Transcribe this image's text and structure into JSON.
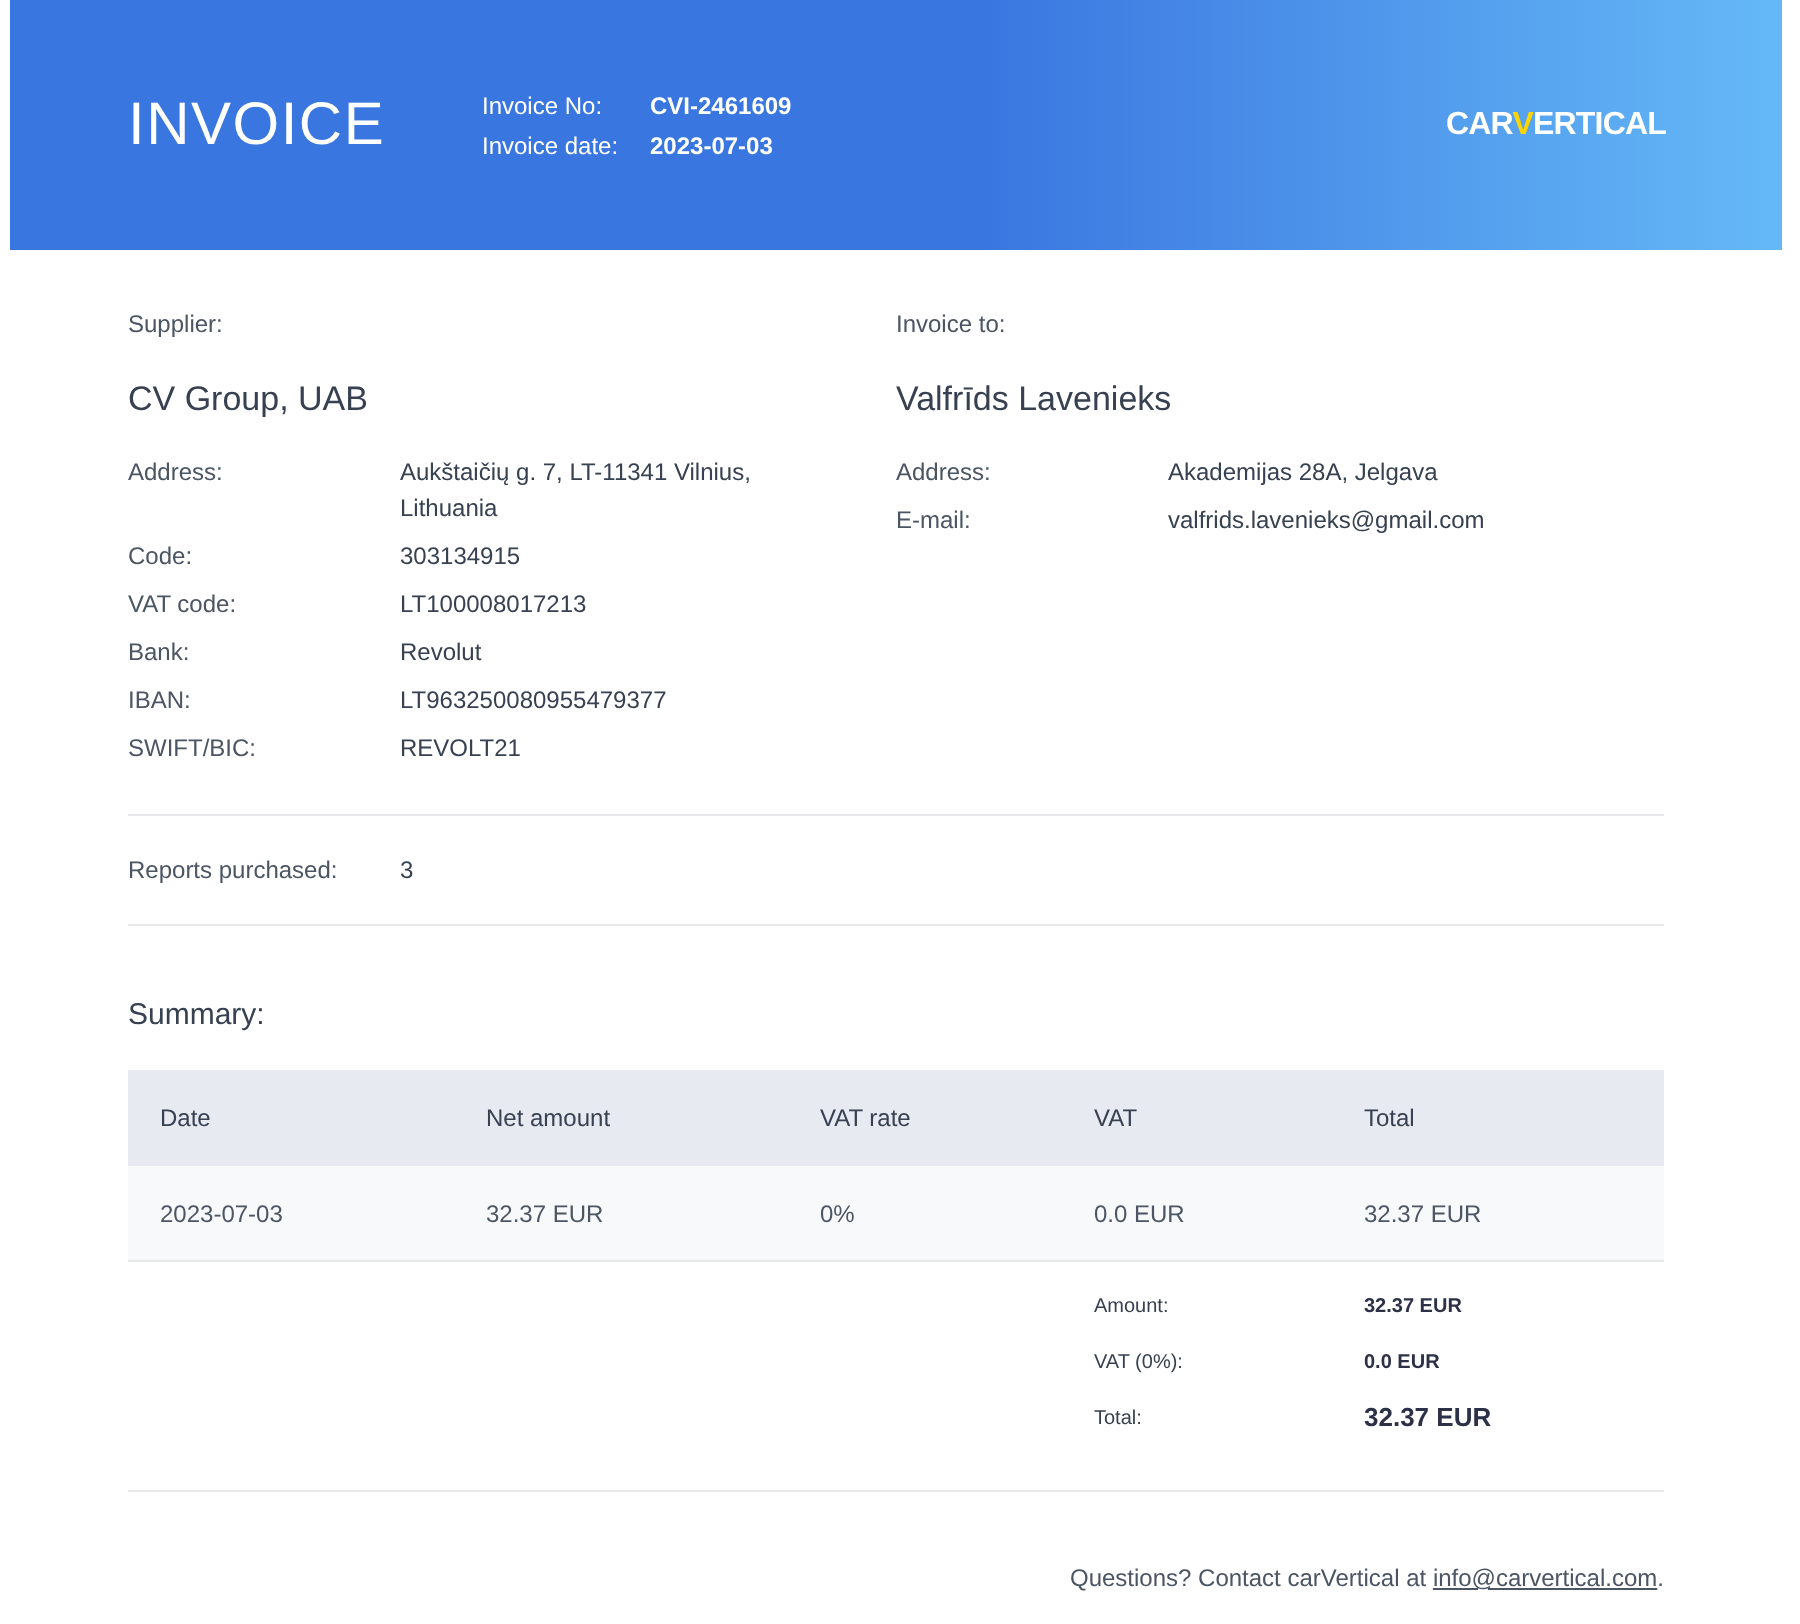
{
  "header": {
    "title": "INVOICE",
    "meta": [
      {
        "label": "Invoice No:",
        "value": "CVI-2461609"
      },
      {
        "label": "Invoice date:",
        "value": "2023-07-03"
      }
    ],
    "logo": {
      "before": "CAR",
      "accent": "V",
      "after": "ERTICAL"
    }
  },
  "supplier": {
    "heading": "Supplier:",
    "name": "CV Group, UAB",
    "fields": [
      {
        "label": "Address:",
        "value": "Aukštaičių g. 7, LT-11341 Vilnius, Lithuania"
      },
      {
        "label": "Code:",
        "value": "303134915"
      },
      {
        "label": "VAT code:",
        "value": "LT100008017213"
      },
      {
        "label": "Bank:",
        "value": "Revolut"
      },
      {
        "label": "IBAN:",
        "value": "LT963250080955479377"
      },
      {
        "label": "SWIFT/BIC:",
        "value": "REVOLT21"
      }
    ]
  },
  "customer": {
    "heading": "Invoice to:",
    "name": "Valfrīds Lavenieks",
    "fields": [
      {
        "label": "Address:",
        "value": "Akademijas 28A, Jelgava"
      },
      {
        "label": "E-mail:",
        "value": "valfrids.lavenieks@gmail.com"
      }
    ]
  },
  "reports": {
    "label": "Reports purchased:",
    "value": "3"
  },
  "summary": {
    "title": "Summary:",
    "columns": [
      "Date",
      "Net amount",
      "VAT rate",
      "VAT",
      "Total"
    ],
    "rows": [
      [
        "2023-07-03",
        "32.37 EUR",
        "0%",
        "0.0 EUR",
        "32.37 EUR"
      ]
    ],
    "totals": [
      {
        "label": "Amount:",
        "value": "32.37 EUR",
        "kind": "normal"
      },
      {
        "label": "VAT (0%):",
        "value": "0.0 EUR",
        "kind": "normal"
      },
      {
        "label": "Total:",
        "value": "32.37 EUR",
        "kind": "grand"
      }
    ]
  },
  "footer": {
    "text": "Questions? Contact carVertical at ",
    "link": "info@carvertical.com",
    "end": "."
  }
}
